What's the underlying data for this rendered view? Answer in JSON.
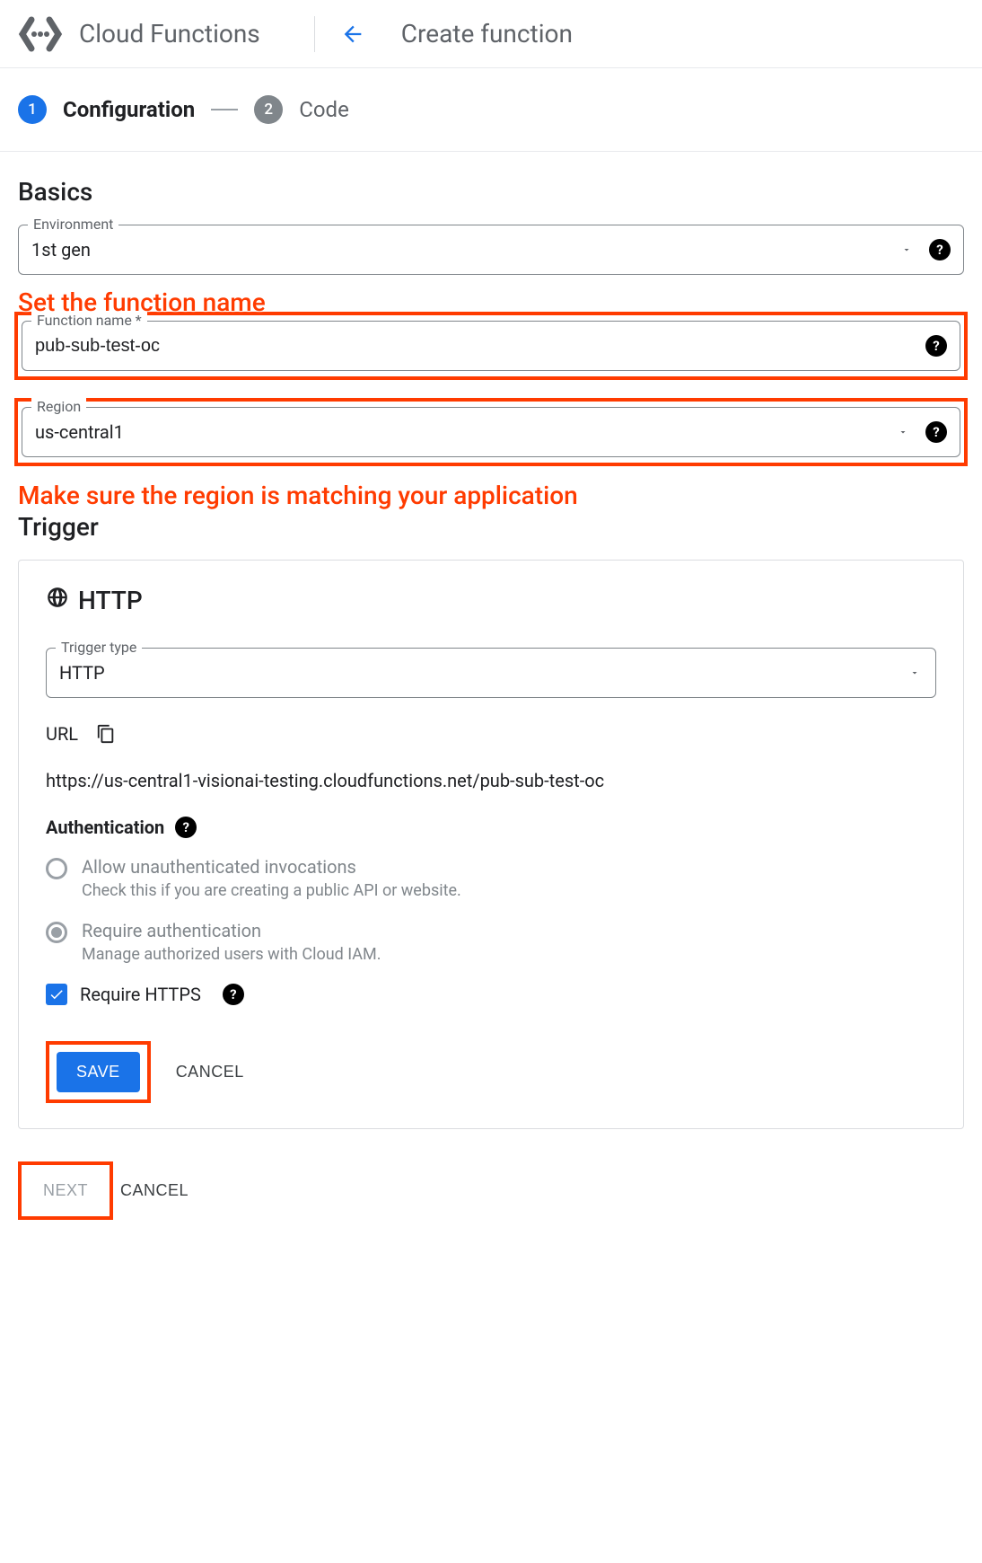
{
  "header": {
    "product": "Cloud Functions",
    "page_title": "Create function"
  },
  "stepper": {
    "step1_num": "1",
    "step1_label": "Configuration",
    "step2_num": "2",
    "step2_label": "Code"
  },
  "basics": {
    "title": "Basics",
    "environment": {
      "label": "Environment",
      "value": "1st gen"
    },
    "function_name": {
      "label": "Function name *",
      "value": "pub-sub-test-oc"
    },
    "region": {
      "label": "Region",
      "value": "us-central1"
    }
  },
  "annotations": {
    "function_name": "Set the function name",
    "region": "Make sure the region is matching your application"
  },
  "trigger": {
    "heading": "Trigger",
    "title": "HTTP",
    "trigger_type": {
      "label": "Trigger type",
      "value": "HTTP"
    },
    "url_label": "URL",
    "url_value": "https://us-central1-visionai-testing.cloudfunctions.net/pub-sub-test-oc",
    "auth": {
      "title": "Authentication",
      "option1_label": "Allow unauthenticated invocations",
      "option1_desc": "Check this if you are creating a public API or website.",
      "option2_label": "Require authentication",
      "option2_desc": "Manage authorized users with Cloud IAM.",
      "selected": "option2"
    },
    "require_https_label": "Require HTTPS",
    "require_https_checked": true,
    "buttons": {
      "save": "SAVE",
      "cancel": "CANCEL"
    }
  },
  "footer": {
    "next": "NEXT",
    "cancel": "CANCEL"
  }
}
